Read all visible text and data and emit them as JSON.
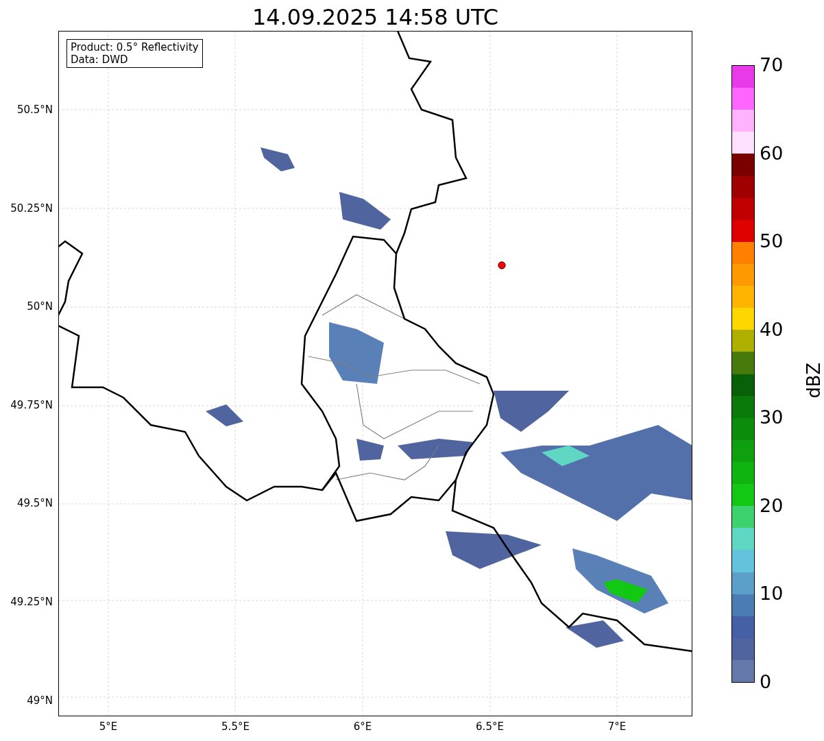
{
  "title": "14.09.2025 14:58 UTC",
  "info_box": [
    "Product: 0.5° Reflectivity",
    "Data: DWD"
  ],
  "y_ticks": [
    "50.5°N",
    "50.25°N",
    "50°N",
    "49.75°N",
    "49.5°N",
    "49.25°N",
    "49°N"
  ],
  "x_ticks": [
    "5°E",
    "5.5°E",
    "6°E",
    "6.5°E",
    "7°E"
  ],
  "colorbar": {
    "label": "dBZ",
    "ticks": [
      "70",
      "60",
      "50",
      "40",
      "30",
      "20",
      "10",
      "0"
    ],
    "segments": [
      {
        "color": "#e83ae8"
      },
      {
        "color": "#ff66ff"
      },
      {
        "color": "#ffb3ff"
      },
      {
        "color": "#ffe0ff"
      },
      {
        "color": "#7a0000"
      },
      {
        "color": "#a00000"
      },
      {
        "color": "#c00000"
      },
      {
        "color": "#e00000"
      },
      {
        "color": "#ff7f00"
      },
      {
        "color": "#ff9900"
      },
      {
        "color": "#ffb400"
      },
      {
        "color": "#ffd700"
      },
      {
        "color": "#afaf00"
      },
      {
        "color": "#467a0a"
      },
      {
        "color": "#086008"
      },
      {
        "color": "#0a7a0a"
      },
      {
        "color": "#0b8c0b"
      },
      {
        "color": "#0ea00e"
      },
      {
        "color": "#10b410"
      },
      {
        "color": "#12c812"
      },
      {
        "color": "#3cd26e"
      },
      {
        "color": "#5fd7c3"
      },
      {
        "color": "#64c3dc"
      },
      {
        "color": "#5aa0c8"
      },
      {
        "color": "#4b7db4"
      },
      {
        "color": "#4660a5"
      },
      {
        "color": "#5064a0"
      },
      {
        "color": "#6478aa"
      }
    ]
  }
}
